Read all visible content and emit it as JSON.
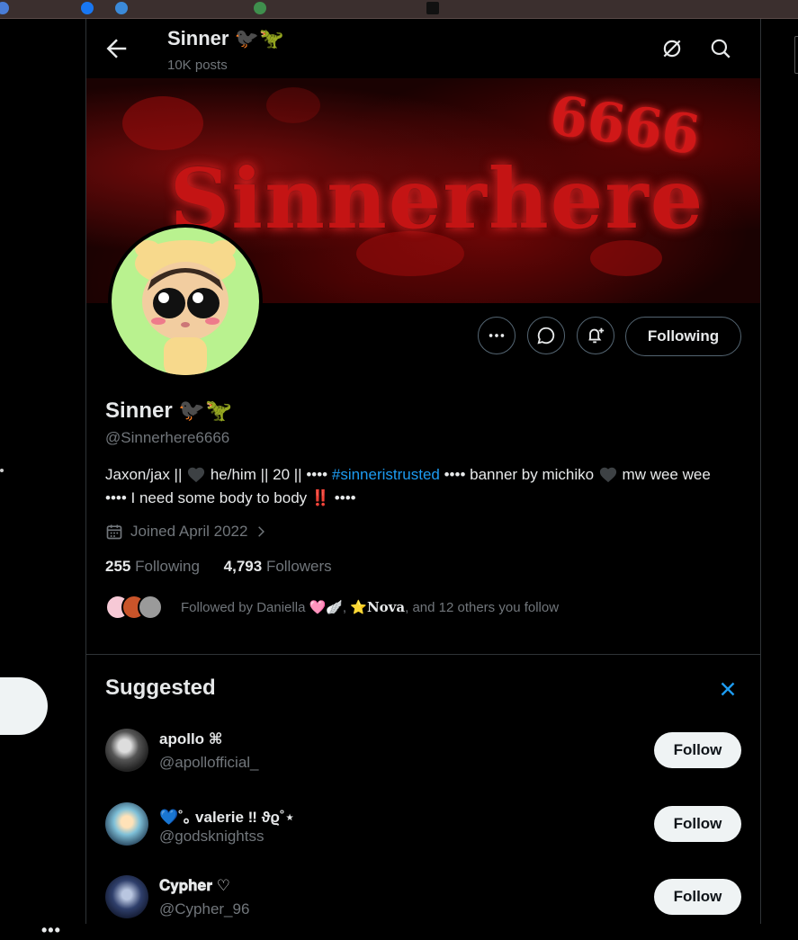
{
  "header": {
    "name": "Sinner 🐦‍⬛🦖",
    "posts": "10K posts"
  },
  "banner": {
    "title": "Sinnerhere",
    "number": "6666"
  },
  "actions": {
    "following_label": "Following"
  },
  "profile": {
    "display_name": "Sinner 🐦‍⬛🦖",
    "handle": "@Sinnerhere6666",
    "bio_part1": "Jaxon/jax || ",
    "bio_part2": " he/him || 20 || •••• ",
    "bio_hashtag": "#sinneristrusted",
    "bio_part3": " •••• banner by michiko ",
    "bio_part4": " mw wee wee •••• I need some body to body ",
    "bio_bang": "‼️",
    "bio_part5": " ••••",
    "joined": "Joined April 2022",
    "following_count": "255",
    "following_label": "Following",
    "followers_count": "4,793",
    "followers_label": "Followers",
    "followed_by_prefix": "Followed by Daniella 🩷🪽, ⭐",
    "followed_by_name": "𝐍𝐨𝐯𝐚",
    "followed_by_suffix": ", and 12 others you follow"
  },
  "suggested": {
    "title": "Suggested",
    "follow_label": "Follow",
    "users": [
      {
        "name": "apollo ⌘",
        "handle": "@apollofficial_"
      },
      {
        "name": "💙˚｡ valerie ‼ ϑϱ˚⋆",
        "handle": "@godsknightss"
      },
      {
        "name": "𝐂𝐲𝐩𝐡𝐞𝐫 ♡",
        "handle": "@Cypher_96"
      }
    ]
  },
  "colors": {
    "accent": "#1d9bf0",
    "muted": "#71767b",
    "border": "#2f3336",
    "avatar_bg": "#b9f28f"
  }
}
